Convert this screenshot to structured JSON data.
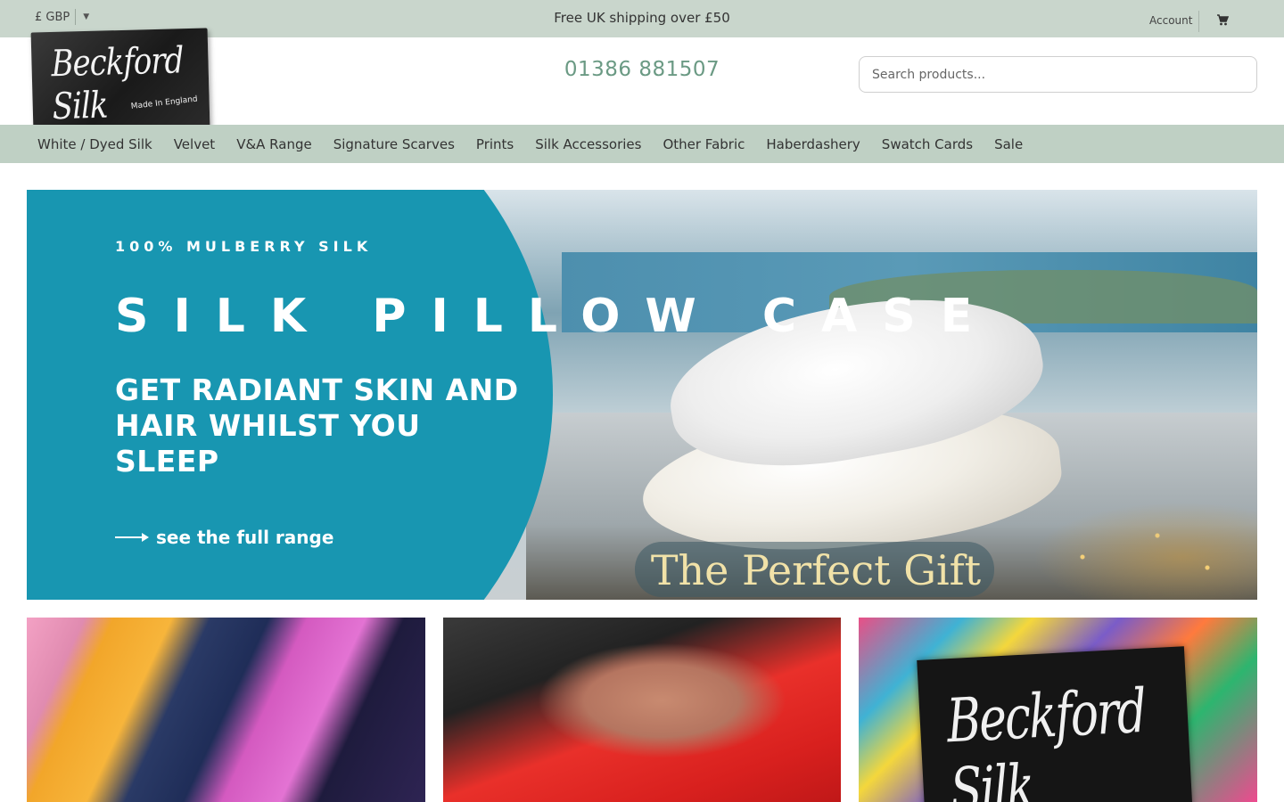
{
  "topbar": {
    "currency": "£ GBP",
    "shipping": "Free UK shipping over £50",
    "account": "Account"
  },
  "header": {
    "logo_text": "Beckford Silk",
    "logo_tagline": "Made In England",
    "phone": "01386 881507",
    "search_placeholder": "Search products..."
  },
  "nav": {
    "items": [
      {
        "label": "White / Dyed Silk"
      },
      {
        "label": "Velvet"
      },
      {
        "label": "V&A Range"
      },
      {
        "label": "Signature Scarves"
      },
      {
        "label": "Prints"
      },
      {
        "label": "Silk Accessories"
      },
      {
        "label": "Other Fabric"
      },
      {
        "label": "Haberdashery"
      },
      {
        "label": "Swatch Cards"
      },
      {
        "label": "Sale"
      }
    ]
  },
  "hero": {
    "eyebrow": "100% MULBERRY SILK",
    "title": "SILK PILLOW CASE",
    "subtitle": "GET RADIANT SKIN AND HAIR WHILST YOU SLEEP",
    "link": "see the full range",
    "badge": "The Perfect Gift"
  },
  "tiles": {
    "label_text": "Beckford Silk"
  },
  "colors": {
    "topbar": "#c9d6cc",
    "nav": "#bfd0c4",
    "phone": "#6b9a84",
    "hero_teal": "#1896b1"
  }
}
